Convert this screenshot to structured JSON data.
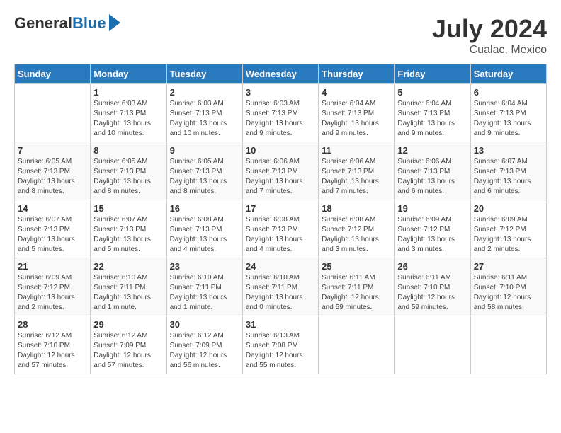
{
  "header": {
    "logo_general": "General",
    "logo_blue": "Blue",
    "month_year": "July 2024",
    "location": "Cualac, Mexico"
  },
  "weekdays": [
    "Sunday",
    "Monday",
    "Tuesday",
    "Wednesday",
    "Thursday",
    "Friday",
    "Saturday"
  ],
  "weeks": [
    [
      {
        "day": "",
        "info": ""
      },
      {
        "day": "1",
        "info": "Sunrise: 6:03 AM\nSunset: 7:13 PM\nDaylight: 13 hours\nand 10 minutes."
      },
      {
        "day": "2",
        "info": "Sunrise: 6:03 AM\nSunset: 7:13 PM\nDaylight: 13 hours\nand 10 minutes."
      },
      {
        "day": "3",
        "info": "Sunrise: 6:03 AM\nSunset: 7:13 PM\nDaylight: 13 hours\nand 9 minutes."
      },
      {
        "day": "4",
        "info": "Sunrise: 6:04 AM\nSunset: 7:13 PM\nDaylight: 13 hours\nand 9 minutes."
      },
      {
        "day": "5",
        "info": "Sunrise: 6:04 AM\nSunset: 7:13 PM\nDaylight: 13 hours\nand 9 minutes."
      },
      {
        "day": "6",
        "info": "Sunrise: 6:04 AM\nSunset: 7:13 PM\nDaylight: 13 hours\nand 9 minutes."
      }
    ],
    [
      {
        "day": "7",
        "info": "Sunrise: 6:05 AM\nSunset: 7:13 PM\nDaylight: 13 hours\nand 8 minutes."
      },
      {
        "day": "8",
        "info": "Sunrise: 6:05 AM\nSunset: 7:13 PM\nDaylight: 13 hours\nand 8 minutes."
      },
      {
        "day": "9",
        "info": "Sunrise: 6:05 AM\nSunset: 7:13 PM\nDaylight: 13 hours\nand 8 minutes."
      },
      {
        "day": "10",
        "info": "Sunrise: 6:06 AM\nSunset: 7:13 PM\nDaylight: 13 hours\nand 7 minutes."
      },
      {
        "day": "11",
        "info": "Sunrise: 6:06 AM\nSunset: 7:13 PM\nDaylight: 13 hours\nand 7 minutes."
      },
      {
        "day": "12",
        "info": "Sunrise: 6:06 AM\nSunset: 7:13 PM\nDaylight: 13 hours\nand 6 minutes."
      },
      {
        "day": "13",
        "info": "Sunrise: 6:07 AM\nSunset: 7:13 PM\nDaylight: 13 hours\nand 6 minutes."
      }
    ],
    [
      {
        "day": "14",
        "info": "Sunrise: 6:07 AM\nSunset: 7:13 PM\nDaylight: 13 hours\nand 5 minutes."
      },
      {
        "day": "15",
        "info": "Sunrise: 6:07 AM\nSunset: 7:13 PM\nDaylight: 13 hours\nand 5 minutes."
      },
      {
        "day": "16",
        "info": "Sunrise: 6:08 AM\nSunset: 7:13 PM\nDaylight: 13 hours\nand 4 minutes."
      },
      {
        "day": "17",
        "info": "Sunrise: 6:08 AM\nSunset: 7:13 PM\nDaylight: 13 hours\nand 4 minutes."
      },
      {
        "day": "18",
        "info": "Sunrise: 6:08 AM\nSunset: 7:12 PM\nDaylight: 13 hours\nand 3 minutes."
      },
      {
        "day": "19",
        "info": "Sunrise: 6:09 AM\nSunset: 7:12 PM\nDaylight: 13 hours\nand 3 minutes."
      },
      {
        "day": "20",
        "info": "Sunrise: 6:09 AM\nSunset: 7:12 PM\nDaylight: 13 hours\nand 2 minutes."
      }
    ],
    [
      {
        "day": "21",
        "info": "Sunrise: 6:09 AM\nSunset: 7:12 PM\nDaylight: 13 hours\nand 2 minutes."
      },
      {
        "day": "22",
        "info": "Sunrise: 6:10 AM\nSunset: 7:11 PM\nDaylight: 13 hours\nand 1 minute."
      },
      {
        "day": "23",
        "info": "Sunrise: 6:10 AM\nSunset: 7:11 PM\nDaylight: 13 hours\nand 1 minute."
      },
      {
        "day": "24",
        "info": "Sunrise: 6:10 AM\nSunset: 7:11 PM\nDaylight: 13 hours\nand 0 minutes."
      },
      {
        "day": "25",
        "info": "Sunrise: 6:11 AM\nSunset: 7:11 PM\nDaylight: 12 hours\nand 59 minutes."
      },
      {
        "day": "26",
        "info": "Sunrise: 6:11 AM\nSunset: 7:10 PM\nDaylight: 12 hours\nand 59 minutes."
      },
      {
        "day": "27",
        "info": "Sunrise: 6:11 AM\nSunset: 7:10 PM\nDaylight: 12 hours\nand 58 minutes."
      }
    ],
    [
      {
        "day": "28",
        "info": "Sunrise: 6:12 AM\nSunset: 7:10 PM\nDaylight: 12 hours\nand 57 minutes."
      },
      {
        "day": "29",
        "info": "Sunrise: 6:12 AM\nSunset: 7:09 PM\nDaylight: 12 hours\nand 57 minutes."
      },
      {
        "day": "30",
        "info": "Sunrise: 6:12 AM\nSunset: 7:09 PM\nDaylight: 12 hours\nand 56 minutes."
      },
      {
        "day": "31",
        "info": "Sunrise: 6:13 AM\nSunset: 7:08 PM\nDaylight: 12 hours\nand 55 minutes."
      },
      {
        "day": "",
        "info": ""
      },
      {
        "day": "",
        "info": ""
      },
      {
        "day": "",
        "info": ""
      }
    ]
  ]
}
